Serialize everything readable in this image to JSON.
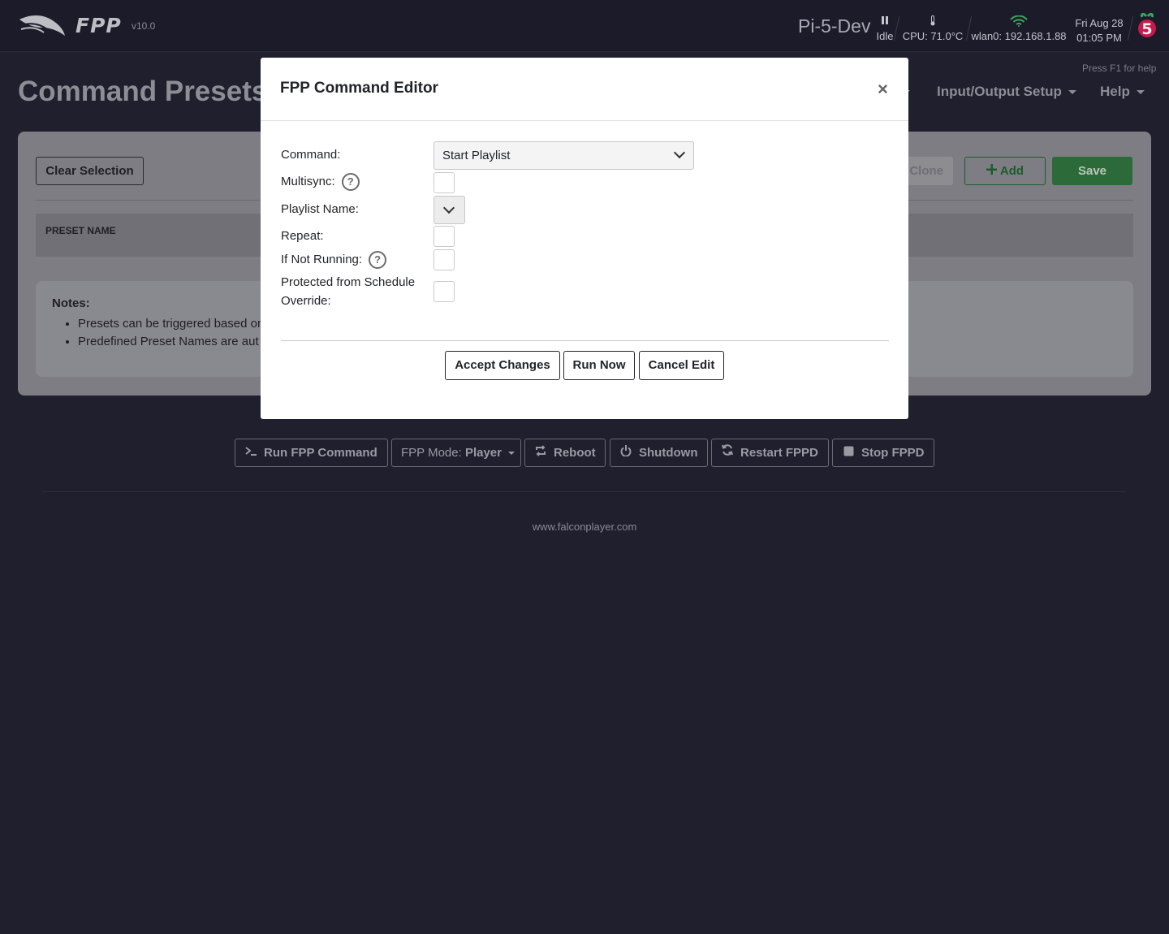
{
  "header": {
    "brand": "FPP",
    "version": "v10.0",
    "hostname": "Pi-5-Dev",
    "status_label": "Idle",
    "cpu_temp": "CPU: 71.0°C",
    "network": "wlan0: 192.168.1.88",
    "date": "Fri Aug 28",
    "time": "01:05 PM",
    "board_badge": "5",
    "icons": {
      "logo": "falcon-logo-icon",
      "status": "pause-icon",
      "temp": "thermometer-icon",
      "network": "wifi-icon",
      "board": "raspberry-pi-icon"
    }
  },
  "page": {
    "help_hint": "Press F1 for help",
    "title": "Command Presets",
    "nav": [
      "Input/Output Setup",
      "Help"
    ],
    "toolbar": {
      "clear_label": "Clear Selection",
      "clone_label": "Clone",
      "add_label": "Add",
      "save_label": "Save"
    },
    "table": {
      "columns": [
        "PRESET NAME"
      ]
    },
    "notes": {
      "title": "Notes:",
      "items": [
        "Presets can be triggered based on",
        "Predefined Preset Names are aut"
      ]
    }
  },
  "footer": {
    "buttons": {
      "run_command": "Run FPP Command",
      "mode_prefix": "FPP Mode:",
      "mode_value": "Player",
      "reboot": "Reboot",
      "shutdown": "Shutdown",
      "restart": "Restart FPPD",
      "stop": "Stop FPPD"
    },
    "link": "www.falconplayer.com"
  },
  "modal": {
    "title": "FPP Command Editor",
    "close": "×",
    "fields": {
      "command_label": "Command:",
      "command_value": "Start Playlist",
      "multisync_label": "Multisync:",
      "playlist_label": "Playlist Name:",
      "playlist_value": "",
      "repeat_label": "Repeat:",
      "if_not_running_label": "If Not Running:",
      "protected_label_1": "Protected from Schedule",
      "protected_label_2": "Override:"
    },
    "help_glyph": "?",
    "buttons": {
      "accept": "Accept Changes",
      "run_now": "Run Now",
      "cancel": "Cancel Edit"
    }
  },
  "colors": {
    "page_bg": "#1f1f2e",
    "modal_bg": "#ffffff",
    "success": "#2c6b39",
    "wifi": "#3ba55c",
    "rpi": "#c51a4a"
  }
}
